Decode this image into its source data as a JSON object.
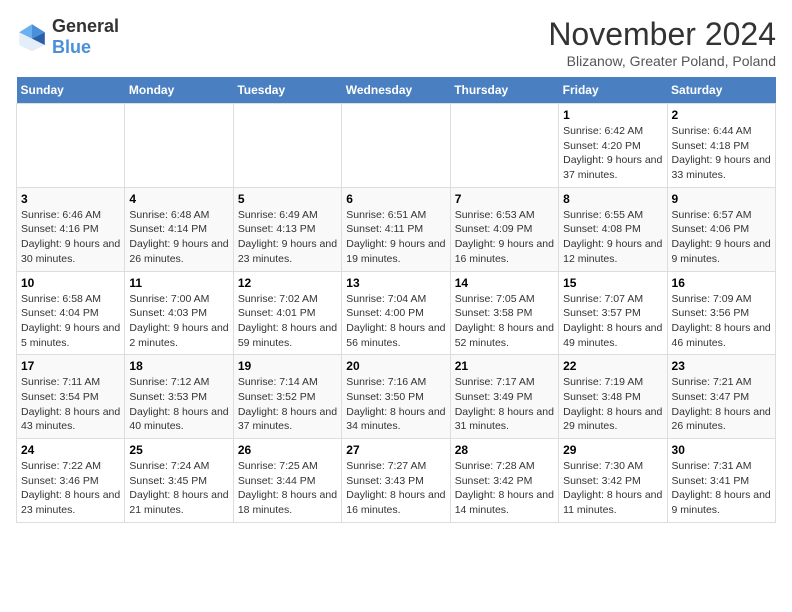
{
  "header": {
    "logo_general": "General",
    "logo_blue": "Blue",
    "title": "November 2024",
    "location": "Blizanow, Greater Poland, Poland"
  },
  "weekdays": [
    "Sunday",
    "Monday",
    "Tuesday",
    "Wednesday",
    "Thursday",
    "Friday",
    "Saturday"
  ],
  "weeks": [
    [
      {
        "day": "",
        "sunrise": "",
        "sunset": "",
        "daylight": ""
      },
      {
        "day": "",
        "sunrise": "",
        "sunset": "",
        "daylight": ""
      },
      {
        "day": "",
        "sunrise": "",
        "sunset": "",
        "daylight": ""
      },
      {
        "day": "",
        "sunrise": "",
        "sunset": "",
        "daylight": ""
      },
      {
        "day": "",
        "sunrise": "",
        "sunset": "",
        "daylight": ""
      },
      {
        "day": "1",
        "sunrise": "Sunrise: 6:42 AM",
        "sunset": "Sunset: 4:20 PM",
        "daylight": "Daylight: 9 hours and 37 minutes."
      },
      {
        "day": "2",
        "sunrise": "Sunrise: 6:44 AM",
        "sunset": "Sunset: 4:18 PM",
        "daylight": "Daylight: 9 hours and 33 minutes."
      }
    ],
    [
      {
        "day": "3",
        "sunrise": "Sunrise: 6:46 AM",
        "sunset": "Sunset: 4:16 PM",
        "daylight": "Daylight: 9 hours and 30 minutes."
      },
      {
        "day": "4",
        "sunrise": "Sunrise: 6:48 AM",
        "sunset": "Sunset: 4:14 PM",
        "daylight": "Daylight: 9 hours and 26 minutes."
      },
      {
        "day": "5",
        "sunrise": "Sunrise: 6:49 AM",
        "sunset": "Sunset: 4:13 PM",
        "daylight": "Daylight: 9 hours and 23 minutes."
      },
      {
        "day": "6",
        "sunrise": "Sunrise: 6:51 AM",
        "sunset": "Sunset: 4:11 PM",
        "daylight": "Daylight: 9 hours and 19 minutes."
      },
      {
        "day": "7",
        "sunrise": "Sunrise: 6:53 AM",
        "sunset": "Sunset: 4:09 PM",
        "daylight": "Daylight: 9 hours and 16 minutes."
      },
      {
        "day": "8",
        "sunrise": "Sunrise: 6:55 AM",
        "sunset": "Sunset: 4:08 PM",
        "daylight": "Daylight: 9 hours and 12 minutes."
      },
      {
        "day": "9",
        "sunrise": "Sunrise: 6:57 AM",
        "sunset": "Sunset: 4:06 PM",
        "daylight": "Daylight: 9 hours and 9 minutes."
      }
    ],
    [
      {
        "day": "10",
        "sunrise": "Sunrise: 6:58 AM",
        "sunset": "Sunset: 4:04 PM",
        "daylight": "Daylight: 9 hours and 5 minutes."
      },
      {
        "day": "11",
        "sunrise": "Sunrise: 7:00 AM",
        "sunset": "Sunset: 4:03 PM",
        "daylight": "Daylight: 9 hours and 2 minutes."
      },
      {
        "day": "12",
        "sunrise": "Sunrise: 7:02 AM",
        "sunset": "Sunset: 4:01 PM",
        "daylight": "Daylight: 8 hours and 59 minutes."
      },
      {
        "day": "13",
        "sunrise": "Sunrise: 7:04 AM",
        "sunset": "Sunset: 4:00 PM",
        "daylight": "Daylight: 8 hours and 56 minutes."
      },
      {
        "day": "14",
        "sunrise": "Sunrise: 7:05 AM",
        "sunset": "Sunset: 3:58 PM",
        "daylight": "Daylight: 8 hours and 52 minutes."
      },
      {
        "day": "15",
        "sunrise": "Sunrise: 7:07 AM",
        "sunset": "Sunset: 3:57 PM",
        "daylight": "Daylight: 8 hours and 49 minutes."
      },
      {
        "day": "16",
        "sunrise": "Sunrise: 7:09 AM",
        "sunset": "Sunset: 3:56 PM",
        "daylight": "Daylight: 8 hours and 46 minutes."
      }
    ],
    [
      {
        "day": "17",
        "sunrise": "Sunrise: 7:11 AM",
        "sunset": "Sunset: 3:54 PM",
        "daylight": "Daylight: 8 hours and 43 minutes."
      },
      {
        "day": "18",
        "sunrise": "Sunrise: 7:12 AM",
        "sunset": "Sunset: 3:53 PM",
        "daylight": "Daylight: 8 hours and 40 minutes."
      },
      {
        "day": "19",
        "sunrise": "Sunrise: 7:14 AM",
        "sunset": "Sunset: 3:52 PM",
        "daylight": "Daylight: 8 hours and 37 minutes."
      },
      {
        "day": "20",
        "sunrise": "Sunrise: 7:16 AM",
        "sunset": "Sunset: 3:50 PM",
        "daylight": "Daylight: 8 hours and 34 minutes."
      },
      {
        "day": "21",
        "sunrise": "Sunrise: 7:17 AM",
        "sunset": "Sunset: 3:49 PM",
        "daylight": "Daylight: 8 hours and 31 minutes."
      },
      {
        "day": "22",
        "sunrise": "Sunrise: 7:19 AM",
        "sunset": "Sunset: 3:48 PM",
        "daylight": "Daylight: 8 hours and 29 minutes."
      },
      {
        "day": "23",
        "sunrise": "Sunrise: 7:21 AM",
        "sunset": "Sunset: 3:47 PM",
        "daylight": "Daylight: 8 hours and 26 minutes."
      }
    ],
    [
      {
        "day": "24",
        "sunrise": "Sunrise: 7:22 AM",
        "sunset": "Sunset: 3:46 PM",
        "daylight": "Daylight: 8 hours and 23 minutes."
      },
      {
        "day": "25",
        "sunrise": "Sunrise: 7:24 AM",
        "sunset": "Sunset: 3:45 PM",
        "daylight": "Daylight: 8 hours and 21 minutes."
      },
      {
        "day": "26",
        "sunrise": "Sunrise: 7:25 AM",
        "sunset": "Sunset: 3:44 PM",
        "daylight": "Daylight: 8 hours and 18 minutes."
      },
      {
        "day": "27",
        "sunrise": "Sunrise: 7:27 AM",
        "sunset": "Sunset: 3:43 PM",
        "daylight": "Daylight: 8 hours and 16 minutes."
      },
      {
        "day": "28",
        "sunrise": "Sunrise: 7:28 AM",
        "sunset": "Sunset: 3:42 PM",
        "daylight": "Daylight: 8 hours and 14 minutes."
      },
      {
        "day": "29",
        "sunrise": "Sunrise: 7:30 AM",
        "sunset": "Sunset: 3:42 PM",
        "daylight": "Daylight: 8 hours and 11 minutes."
      },
      {
        "day": "30",
        "sunrise": "Sunrise: 7:31 AM",
        "sunset": "Sunset: 3:41 PM",
        "daylight": "Daylight: 8 hours and 9 minutes."
      }
    ]
  ]
}
